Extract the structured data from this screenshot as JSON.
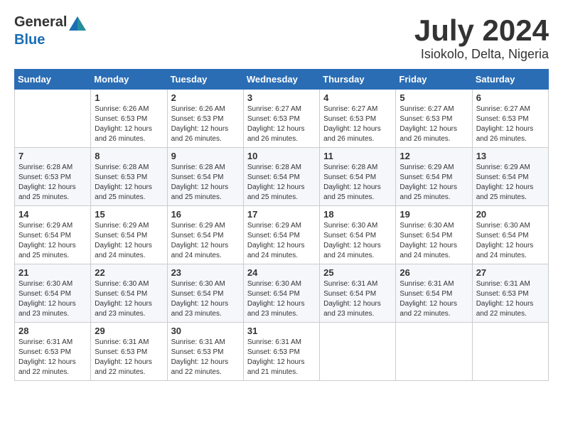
{
  "header": {
    "logo_general": "General",
    "logo_blue": "Blue",
    "month": "July 2024",
    "location": "Isiokolo, Delta, Nigeria"
  },
  "weekdays": [
    "Sunday",
    "Monday",
    "Tuesday",
    "Wednesday",
    "Thursday",
    "Friday",
    "Saturday"
  ],
  "weeks": [
    [
      {
        "day": "",
        "info": ""
      },
      {
        "day": "1",
        "info": "Sunrise: 6:26 AM\nSunset: 6:53 PM\nDaylight: 12 hours\nand 26 minutes."
      },
      {
        "day": "2",
        "info": "Sunrise: 6:26 AM\nSunset: 6:53 PM\nDaylight: 12 hours\nand 26 minutes."
      },
      {
        "day": "3",
        "info": "Sunrise: 6:27 AM\nSunset: 6:53 PM\nDaylight: 12 hours\nand 26 minutes."
      },
      {
        "day": "4",
        "info": "Sunrise: 6:27 AM\nSunset: 6:53 PM\nDaylight: 12 hours\nand 26 minutes."
      },
      {
        "day": "5",
        "info": "Sunrise: 6:27 AM\nSunset: 6:53 PM\nDaylight: 12 hours\nand 26 minutes."
      },
      {
        "day": "6",
        "info": "Sunrise: 6:27 AM\nSunset: 6:53 PM\nDaylight: 12 hours\nand 26 minutes."
      }
    ],
    [
      {
        "day": "7",
        "info": "Sunrise: 6:28 AM\nSunset: 6:53 PM\nDaylight: 12 hours\nand 25 minutes."
      },
      {
        "day": "8",
        "info": "Sunrise: 6:28 AM\nSunset: 6:53 PM\nDaylight: 12 hours\nand 25 minutes."
      },
      {
        "day": "9",
        "info": "Sunrise: 6:28 AM\nSunset: 6:54 PM\nDaylight: 12 hours\nand 25 minutes."
      },
      {
        "day": "10",
        "info": "Sunrise: 6:28 AM\nSunset: 6:54 PM\nDaylight: 12 hours\nand 25 minutes."
      },
      {
        "day": "11",
        "info": "Sunrise: 6:28 AM\nSunset: 6:54 PM\nDaylight: 12 hours\nand 25 minutes."
      },
      {
        "day": "12",
        "info": "Sunrise: 6:29 AM\nSunset: 6:54 PM\nDaylight: 12 hours\nand 25 minutes."
      },
      {
        "day": "13",
        "info": "Sunrise: 6:29 AM\nSunset: 6:54 PM\nDaylight: 12 hours\nand 25 minutes."
      }
    ],
    [
      {
        "day": "14",
        "info": "Sunrise: 6:29 AM\nSunset: 6:54 PM\nDaylight: 12 hours\nand 25 minutes."
      },
      {
        "day": "15",
        "info": "Sunrise: 6:29 AM\nSunset: 6:54 PM\nDaylight: 12 hours\nand 24 minutes."
      },
      {
        "day": "16",
        "info": "Sunrise: 6:29 AM\nSunset: 6:54 PM\nDaylight: 12 hours\nand 24 minutes."
      },
      {
        "day": "17",
        "info": "Sunrise: 6:29 AM\nSunset: 6:54 PM\nDaylight: 12 hours\nand 24 minutes."
      },
      {
        "day": "18",
        "info": "Sunrise: 6:30 AM\nSunset: 6:54 PM\nDaylight: 12 hours\nand 24 minutes."
      },
      {
        "day": "19",
        "info": "Sunrise: 6:30 AM\nSunset: 6:54 PM\nDaylight: 12 hours\nand 24 minutes."
      },
      {
        "day": "20",
        "info": "Sunrise: 6:30 AM\nSunset: 6:54 PM\nDaylight: 12 hours\nand 24 minutes."
      }
    ],
    [
      {
        "day": "21",
        "info": "Sunrise: 6:30 AM\nSunset: 6:54 PM\nDaylight: 12 hours\nand 23 minutes."
      },
      {
        "day": "22",
        "info": "Sunrise: 6:30 AM\nSunset: 6:54 PM\nDaylight: 12 hours\nand 23 minutes."
      },
      {
        "day": "23",
        "info": "Sunrise: 6:30 AM\nSunset: 6:54 PM\nDaylight: 12 hours\nand 23 minutes."
      },
      {
        "day": "24",
        "info": "Sunrise: 6:30 AM\nSunset: 6:54 PM\nDaylight: 12 hours\nand 23 minutes."
      },
      {
        "day": "25",
        "info": "Sunrise: 6:31 AM\nSunset: 6:54 PM\nDaylight: 12 hours\nand 23 minutes."
      },
      {
        "day": "26",
        "info": "Sunrise: 6:31 AM\nSunset: 6:54 PM\nDaylight: 12 hours\nand 22 minutes."
      },
      {
        "day": "27",
        "info": "Sunrise: 6:31 AM\nSunset: 6:53 PM\nDaylight: 12 hours\nand 22 minutes."
      }
    ],
    [
      {
        "day": "28",
        "info": "Sunrise: 6:31 AM\nSunset: 6:53 PM\nDaylight: 12 hours\nand 22 minutes."
      },
      {
        "day": "29",
        "info": "Sunrise: 6:31 AM\nSunset: 6:53 PM\nDaylight: 12 hours\nand 22 minutes."
      },
      {
        "day": "30",
        "info": "Sunrise: 6:31 AM\nSunset: 6:53 PM\nDaylight: 12 hours\nand 22 minutes."
      },
      {
        "day": "31",
        "info": "Sunrise: 6:31 AM\nSunset: 6:53 PM\nDaylight: 12 hours\nand 21 minutes."
      },
      {
        "day": "",
        "info": ""
      },
      {
        "day": "",
        "info": ""
      },
      {
        "day": "",
        "info": ""
      }
    ]
  ]
}
